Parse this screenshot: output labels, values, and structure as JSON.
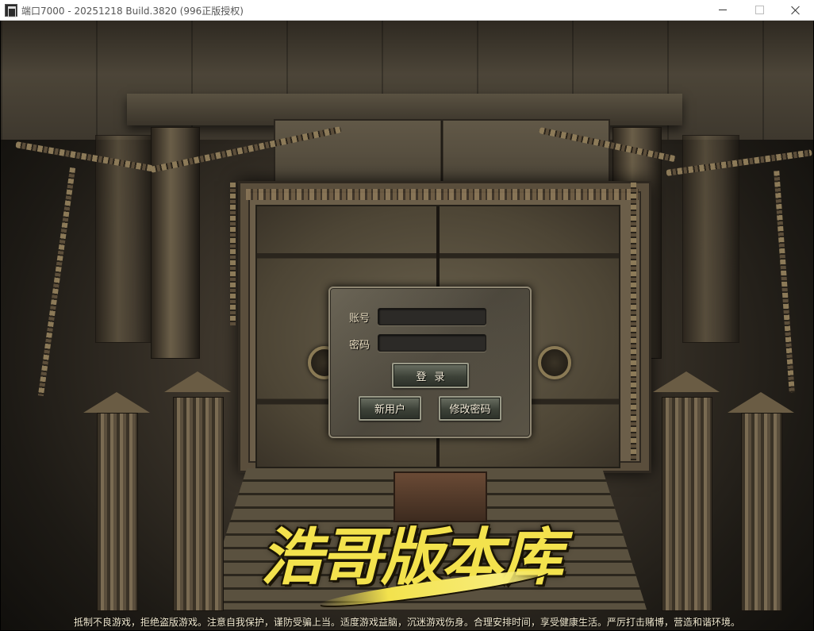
{
  "window": {
    "title": "端口7000 - 20251218 Build.3820 (996正版授权)",
    "icon": "app-icon"
  },
  "login": {
    "account_label": "账号",
    "password_label": "密码",
    "account_value": "",
    "password_value": "",
    "login_button": "登录",
    "new_user_button": "新用户",
    "change_password_button": "修改密码"
  },
  "logo": {
    "text": "浩哥版本库",
    "color": "#f3e24d"
  },
  "footer": {
    "notice": "抵制不良游戏，拒绝盗版游戏。注意自我保护，谨防受骗上当。适度游戏益脑，沉迷游戏伤身。合理安排时间，享受健康生活。严厉打击赌博，营造和谐环境。"
  },
  "colors": {
    "panel_border": "#8e8672",
    "button_text": "#f4ecd8",
    "label_text": "#e8dcc0"
  }
}
